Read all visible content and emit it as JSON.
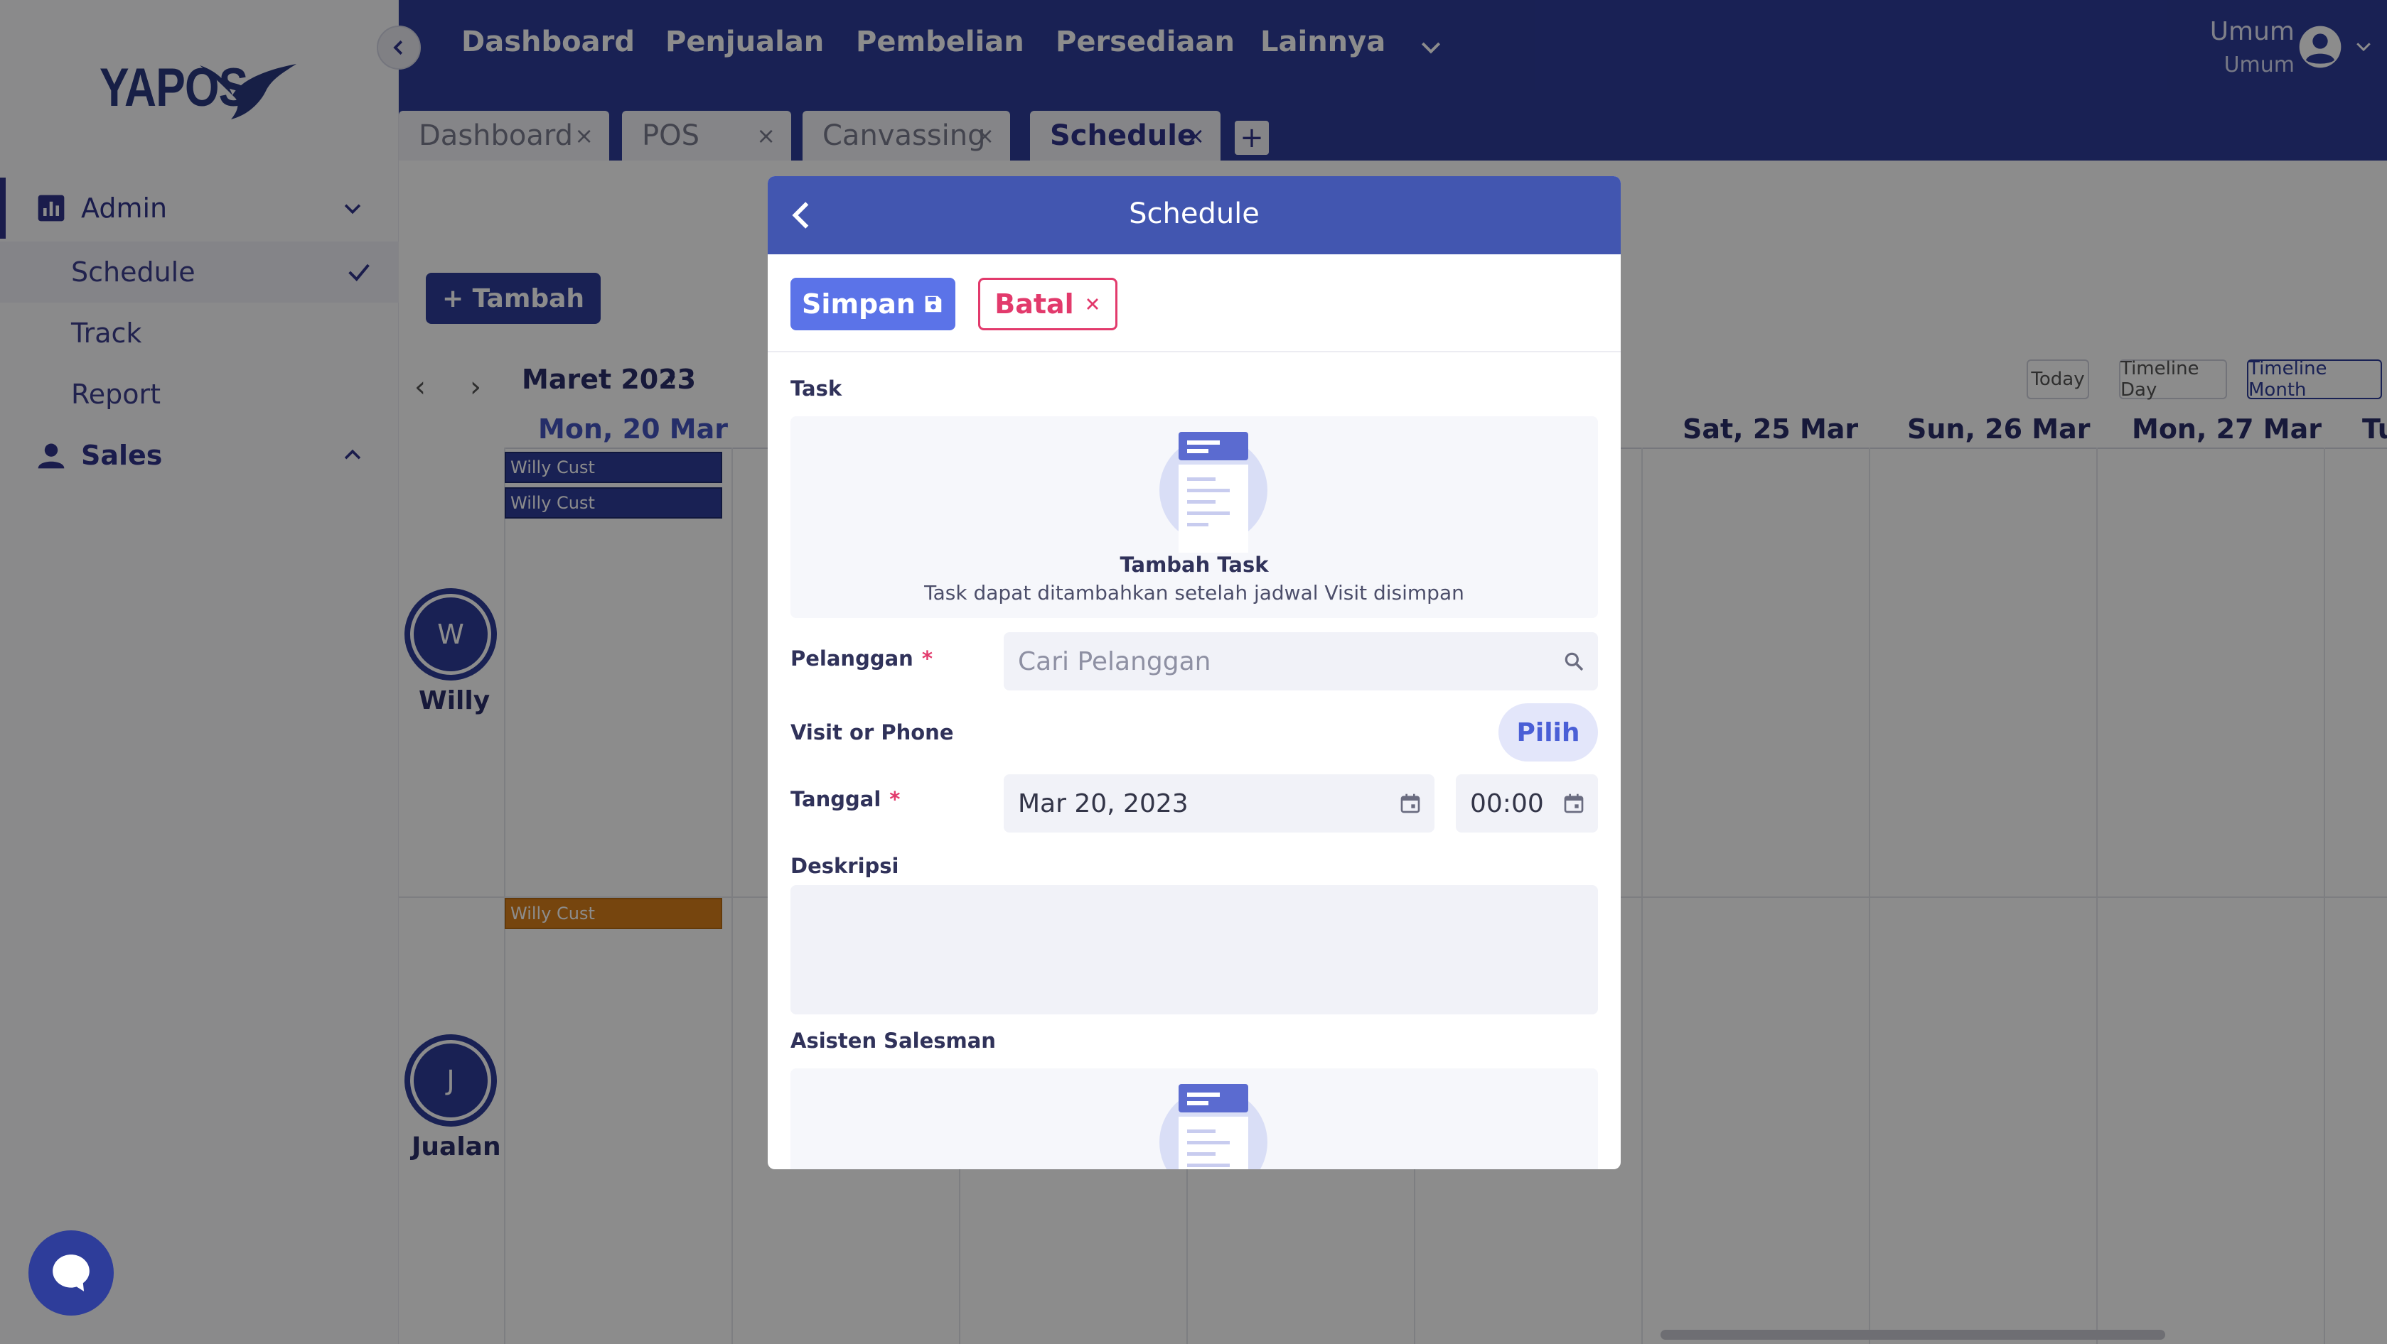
{
  "sidebar": {
    "logo": "YAPOS",
    "sections": [
      {
        "label": "Admin",
        "icon": "bar-chart-icon",
        "expanded": true,
        "items": [
          {
            "label": "Schedule",
            "active": true
          },
          {
            "label": "Track"
          },
          {
            "label": "Report"
          }
        ]
      },
      {
        "label": "Sales",
        "icon": "person-icon",
        "expanded": false
      }
    ]
  },
  "topnav": {
    "links": [
      "Dashboard",
      "Penjualan",
      "Pembelian",
      "Persediaan",
      "Lainnya"
    ],
    "user": {
      "name": "Umum",
      "role": "Umum"
    }
  },
  "tabs": [
    {
      "label": "Dashboard",
      "close": "×"
    },
    {
      "label": "POS",
      "close": "×"
    },
    {
      "label": "Canvassing",
      "close": "×"
    },
    {
      "label": "Schedule",
      "close": "×",
      "active": true
    }
  ],
  "tab_add": "+",
  "calendar": {
    "add_button": "+ Tambah",
    "month": "Maret 2023",
    "views": [
      "Today",
      "Timeline Day",
      "Timeline Month"
    ],
    "selected_view": "Timeline Month",
    "days": [
      "Mon, 20 Mar",
      "Sat, 25 Mar",
      "Sun, 26 Mar",
      "Mon, 27 Mar",
      "Tu"
    ],
    "resources": [
      {
        "initial": "W",
        "name": "Willy"
      },
      {
        "initial": "J",
        "name": "Jualan"
      }
    ],
    "events": [
      "Willy Cust",
      "Willy Cust",
      "Willy Cust"
    ]
  },
  "modal": {
    "title": "Schedule",
    "save_label": "Simpan",
    "cancel_label": "Batal",
    "task": {
      "label": "Task",
      "empty_title": "Tambah Task",
      "empty_sub": "Task dapat ditambahkan setelah jadwal Visit disimpan"
    },
    "customer": {
      "label": "Pelanggan",
      "required": "*",
      "placeholder": "Cari Pelanggan"
    },
    "visit": {
      "label": "Visit or Phone",
      "button": "Pilih"
    },
    "date": {
      "label": "Tanggal",
      "required": "*",
      "value": "Mar 20, 2023",
      "time": "00:00"
    },
    "description": {
      "label": "Deskripsi",
      "value": ""
    },
    "assistant": {
      "label": "Asisten Salesman"
    }
  },
  "colors": {
    "primary": "#2e3d9a",
    "modal_header": "#4256b0",
    "save": "#5b73e8",
    "cancel": "#e23a6c",
    "event_orange": "#d77f1a"
  }
}
